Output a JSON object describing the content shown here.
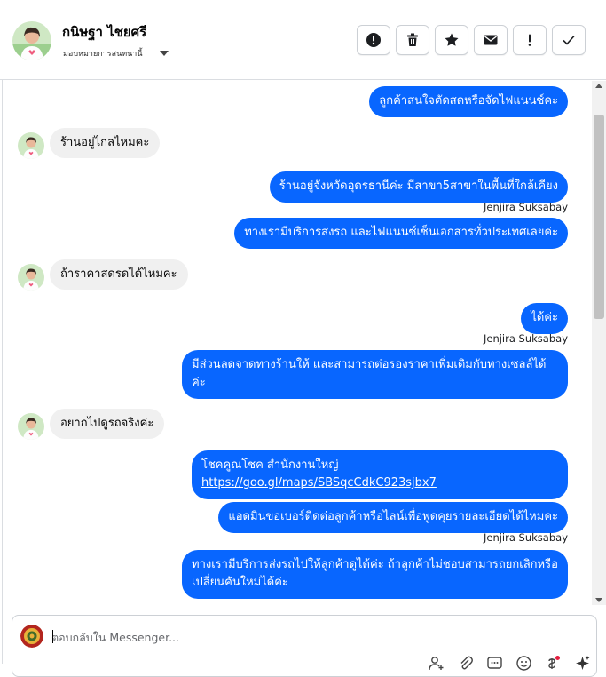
{
  "header": {
    "contact_name": "กนิษฐา ไชยศรี",
    "assign_label": "มอบหมายการสนทนานี้"
  },
  "actions": [
    {
      "name": "report-spam-button",
      "icon": "alert-circle-icon"
    },
    {
      "name": "delete-button",
      "icon": "trash-icon"
    },
    {
      "name": "star-button",
      "icon": "star-icon"
    },
    {
      "name": "mark-unread-button",
      "icon": "envelope-icon"
    },
    {
      "name": "follow-up-button",
      "icon": "exclamation-icon"
    },
    {
      "name": "mark-done-button",
      "icon": "check-icon"
    }
  ],
  "messages": {
    "m1": "ลูกค้าสนใจตัดสดหรือจัดไฟแนนซ์คะ",
    "m2": "ร้านอยู่ไกลไหมคะ",
    "m3": "ร้านอยู่จังหวัดอุดรธานีค่ะ มีสาขา5สาขาในพื้นที่ใกล้เคียง",
    "m4": "ทางเรามีบริการส่งรถ และไฟแนนซ์เช็นเอกสารทั่วประเทศเลยค่ะ",
    "m5": "ถ้าราคาสดรดได้ไหมคะ",
    "m6": "ได้ค่ะ",
    "m7": "มีส่วนลดจาดทางร้านให้ และสามารถต่อรองราคาเพิ่มเติมกับทางเซลล์ได้ค่ะ",
    "m8": "อยากไปดูรถจริงค่ะ",
    "m9_line1": "โชคคูณโชค สำนักงานใหญ่",
    "m9_link": "https://goo.gl/maps/SBSqcCdkC923sjbx7",
    "m10": "แอดมินขอเบอร์ติดต่อลูกค้าหรือไลน์เพื่อพูดคุยรายละเอียดได้ไหมคะ",
    "m11": "ทางเรามีบริการส่งรถไปให้ลูกค้าดูได้ค่ะ ถ้าลูกค้าไม่ชอบสามารถยกเลิกหรือเปลี่ยนคันใหม่ได้ค่ะ"
  },
  "agent_name": "Jenjira Suksabay",
  "composer": {
    "placeholder": "ตอบกลับใน Messenger..."
  },
  "composer_tools": [
    "add-person-icon",
    "paperclip-icon",
    "saved-replies-icon",
    "emoji-icon",
    "payment-icon",
    "sparkle-icon"
  ],
  "colors": {
    "outgoing_bubble": "#0866ff",
    "incoming_bubble": "#f0f0f0",
    "notification_dot": "#e41e3f"
  }
}
